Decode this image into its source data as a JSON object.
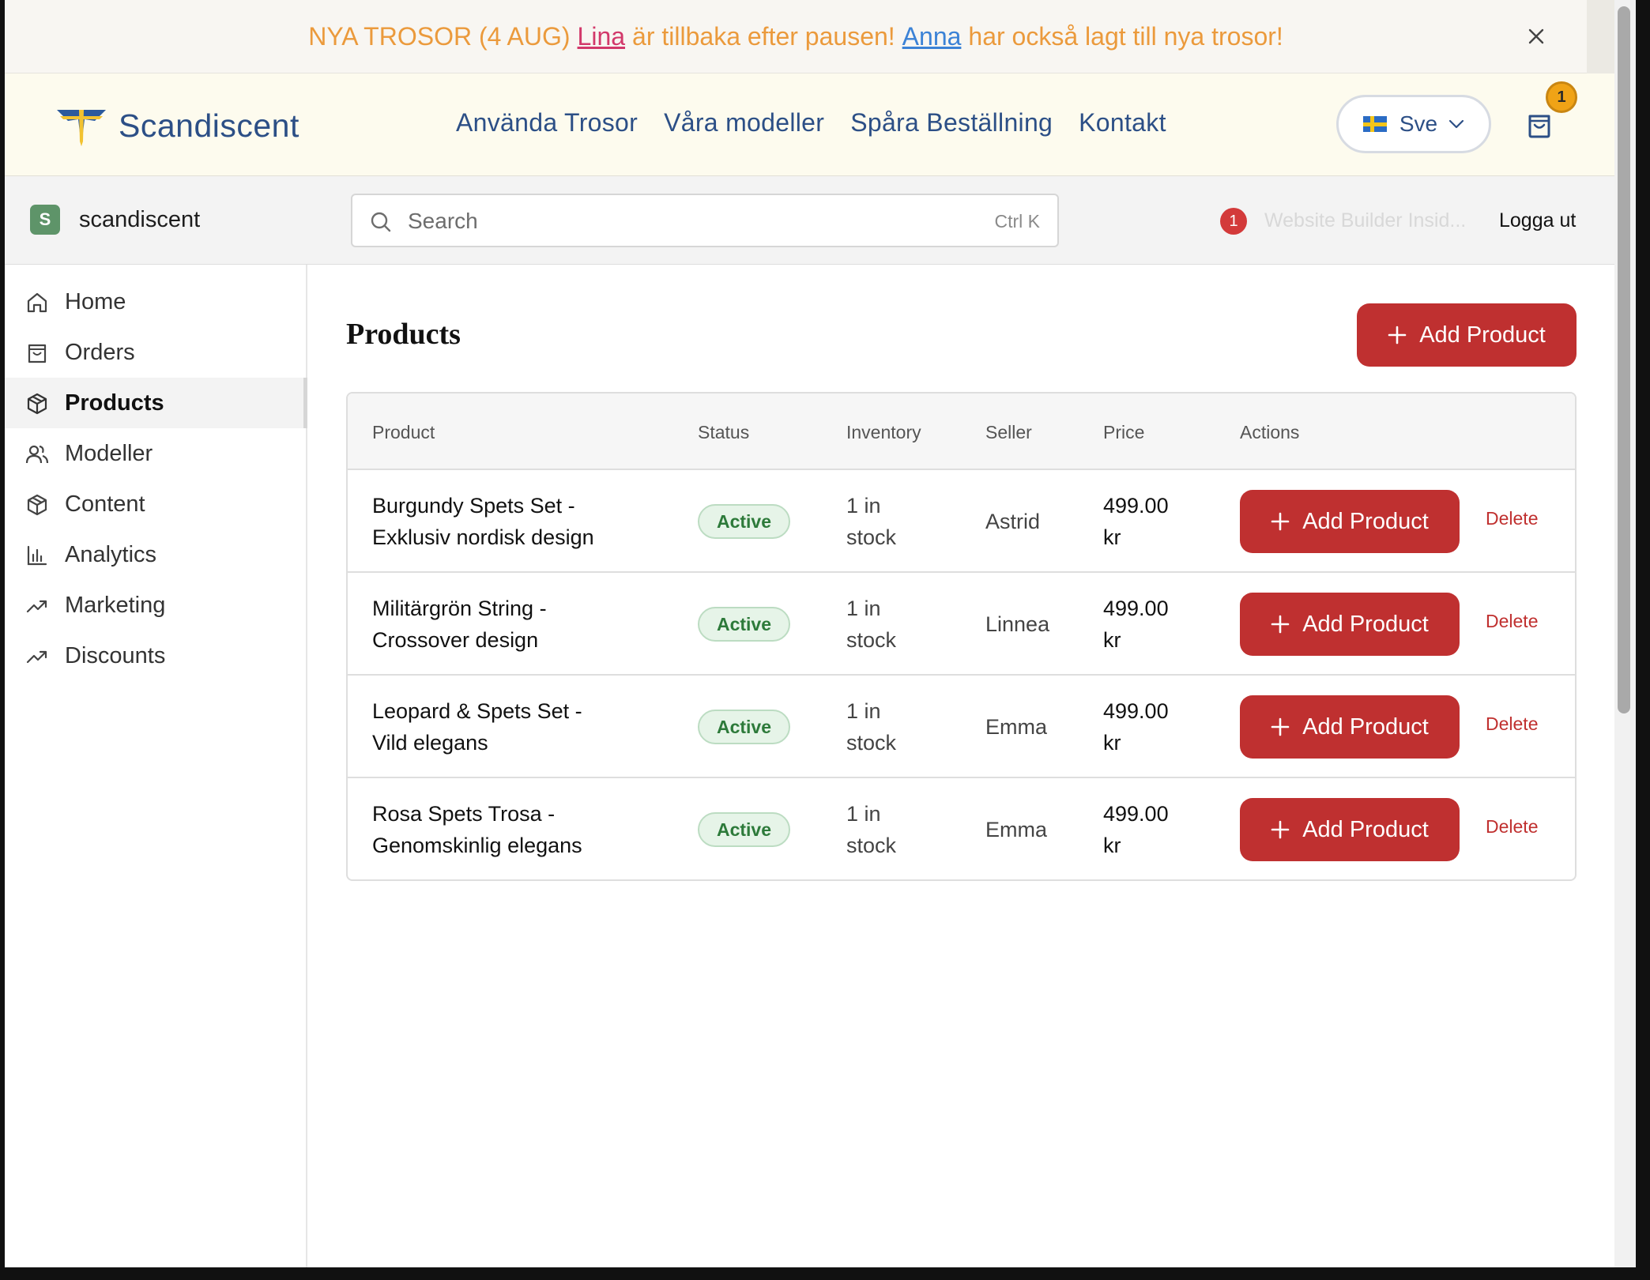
{
  "announcement": {
    "prefix": "NYA TROSOR (4 AUG)",
    "link1": "Lina",
    "middle": "är tillbaka efter pausen!",
    "link2": "Anna",
    "suffix": "har också lagt till nya trosor!",
    "colors": {
      "text": "#eb9a3c",
      "link1": "#d2386a",
      "link2": "#3b82d6"
    }
  },
  "site_header": {
    "brand": "Scandiscent",
    "nav": [
      "Använda Trosor",
      "Våra modeller",
      "Spåra Beställning",
      "Kontakt"
    ],
    "language": "Sve",
    "cart_count": "1"
  },
  "admin_bar": {
    "store_initial": "S",
    "store_name": "scandiscent",
    "search_placeholder": "Search",
    "search_shortcut": "Ctrl K",
    "notification_count": "1",
    "website_builder_label": "Website Builder Insid...",
    "logout_label": "Logga ut"
  },
  "sidebar": {
    "items": [
      {
        "label": "Home",
        "icon": "home-icon"
      },
      {
        "label": "Orders",
        "icon": "bag-icon"
      },
      {
        "label": "Products",
        "icon": "box-icon",
        "active": true
      },
      {
        "label": "Modeller",
        "icon": "users-icon"
      },
      {
        "label": "Content",
        "icon": "box-icon"
      },
      {
        "label": "Analytics",
        "icon": "bar-chart-icon"
      },
      {
        "label": "Marketing",
        "icon": "trend-icon"
      },
      {
        "label": "Discounts",
        "icon": "trend-icon"
      }
    ]
  },
  "main": {
    "title": "Products",
    "add_label": "Add Product",
    "accent_color": "#bf3030",
    "columns": [
      "Product",
      "Status",
      "Inventory",
      "Seller",
      "Price",
      "Actions"
    ],
    "rows": [
      {
        "product_line1": "Burgundy Spets Set -",
        "product_line2": "Exklusiv nordisk design",
        "status": "Active",
        "inventory_line1": "1 in",
        "inventory_line2": "stock",
        "seller": "Astrid",
        "price_line1": "499.00",
        "price_line2": "kr",
        "add_label": "Add Product",
        "delete_label": "Delete"
      },
      {
        "product_line1": "Militärgrön String -",
        "product_line2": "Crossover design",
        "status": "Active",
        "inventory_line1": "1 in",
        "inventory_line2": "stock",
        "seller": "Linnea",
        "price_line1": "499.00",
        "price_line2": "kr",
        "add_label": "Add Product",
        "delete_label": "Delete"
      },
      {
        "product_line1": "Leopard & Spets Set -",
        "product_line2": "Vild elegans",
        "status": "Active",
        "inventory_line1": "1 in",
        "inventory_line2": "stock",
        "seller": "Emma",
        "price_line1": "499.00",
        "price_line2": "kr",
        "add_label": "Add Product",
        "delete_label": "Delete"
      },
      {
        "product_line1": "Rosa Spets Trosa -",
        "product_line2": "Genomskinlig elegans",
        "status": "Active",
        "inventory_line1": "1 in",
        "inventory_line2": "stock",
        "seller": "Emma",
        "price_line1": "499.00",
        "price_line2": "kr",
        "add_label": "Add Product",
        "delete_label": "Delete"
      }
    ]
  }
}
